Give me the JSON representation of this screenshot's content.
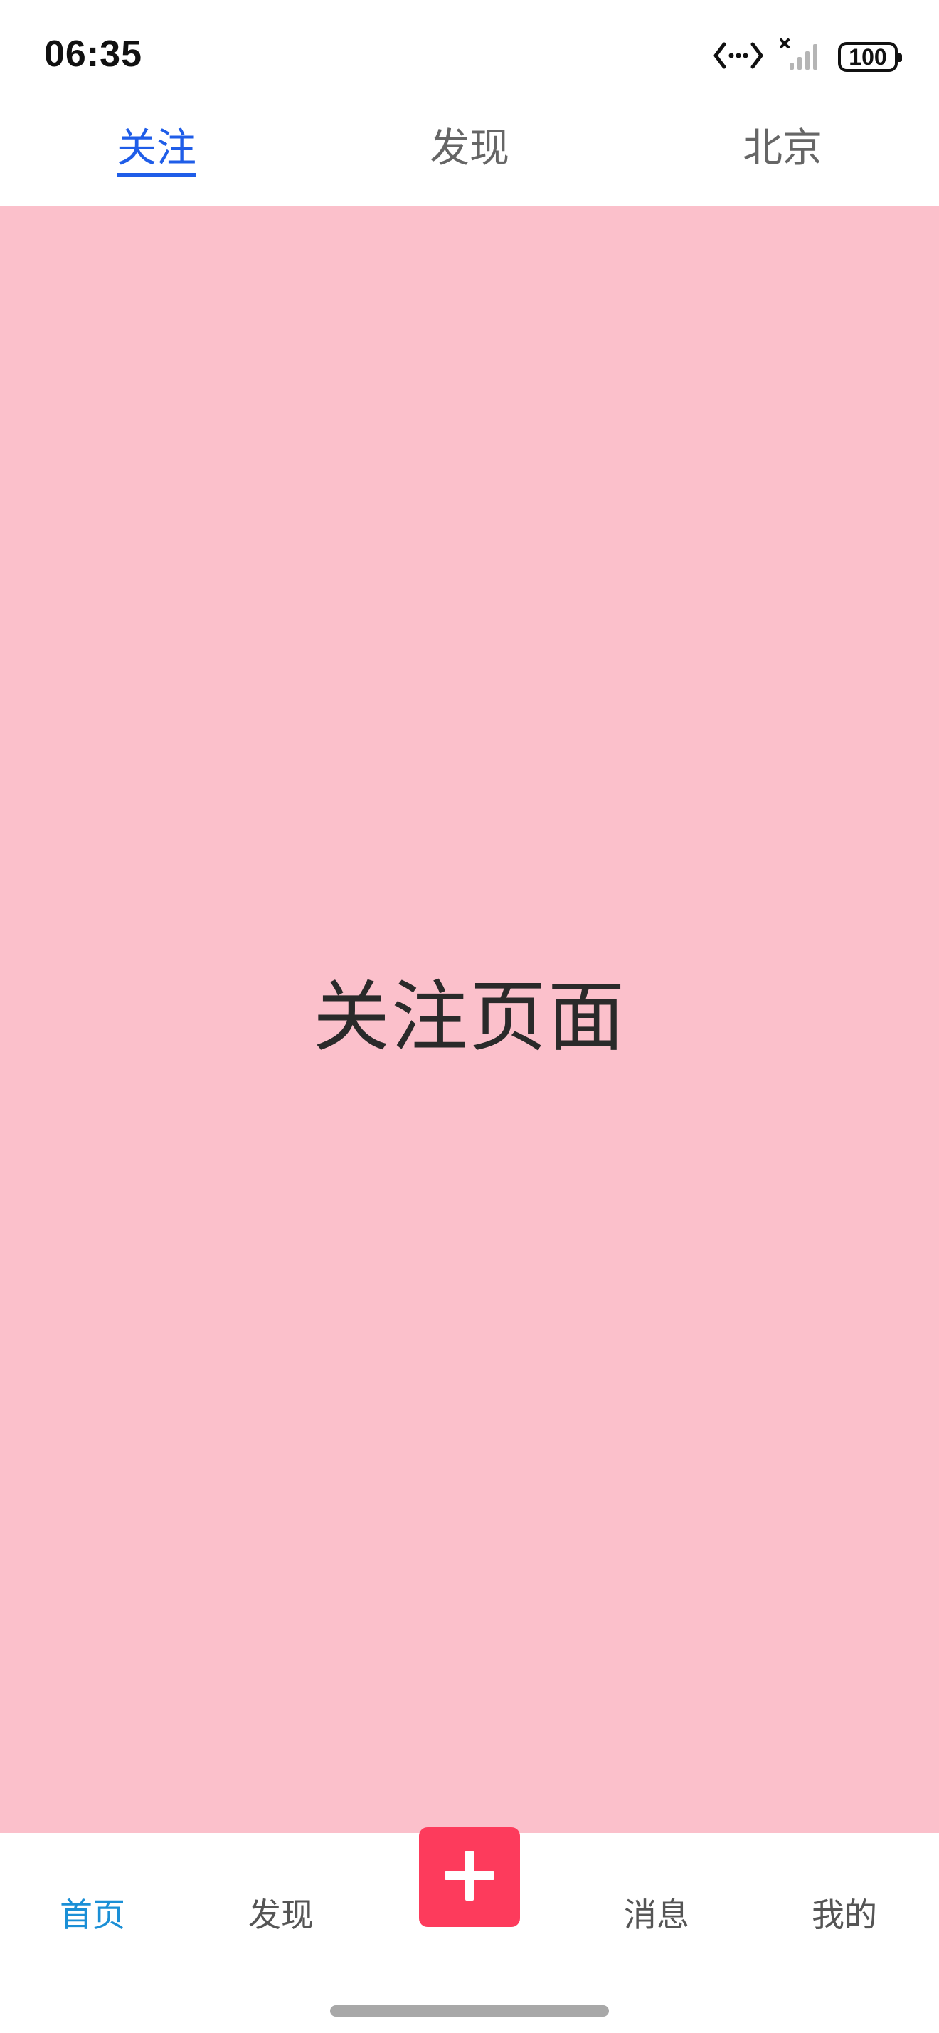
{
  "status_bar": {
    "time": "06:35",
    "battery": "100",
    "icons": [
      "data-transfer-icon",
      "no-signal-icon",
      "battery-icon"
    ]
  },
  "top_tabs": [
    {
      "label": "关注",
      "active": true
    },
    {
      "label": "发现",
      "active": false
    },
    {
      "label": "北京",
      "active": false
    }
  ],
  "content": {
    "title": "关注页面",
    "background_color": "#fbc0cb"
  },
  "bottom_nav": {
    "items": [
      {
        "label": "首页",
        "active": true
      },
      {
        "label": "发现",
        "active": false
      },
      {
        "label": "消息",
        "active": false
      },
      {
        "label": "我的",
        "active": false
      }
    ],
    "add_icon": "plus-icon",
    "add_color": "#fd3b5c",
    "active_color": "#1a8fd6"
  },
  "accent_color": "#1f5de8"
}
